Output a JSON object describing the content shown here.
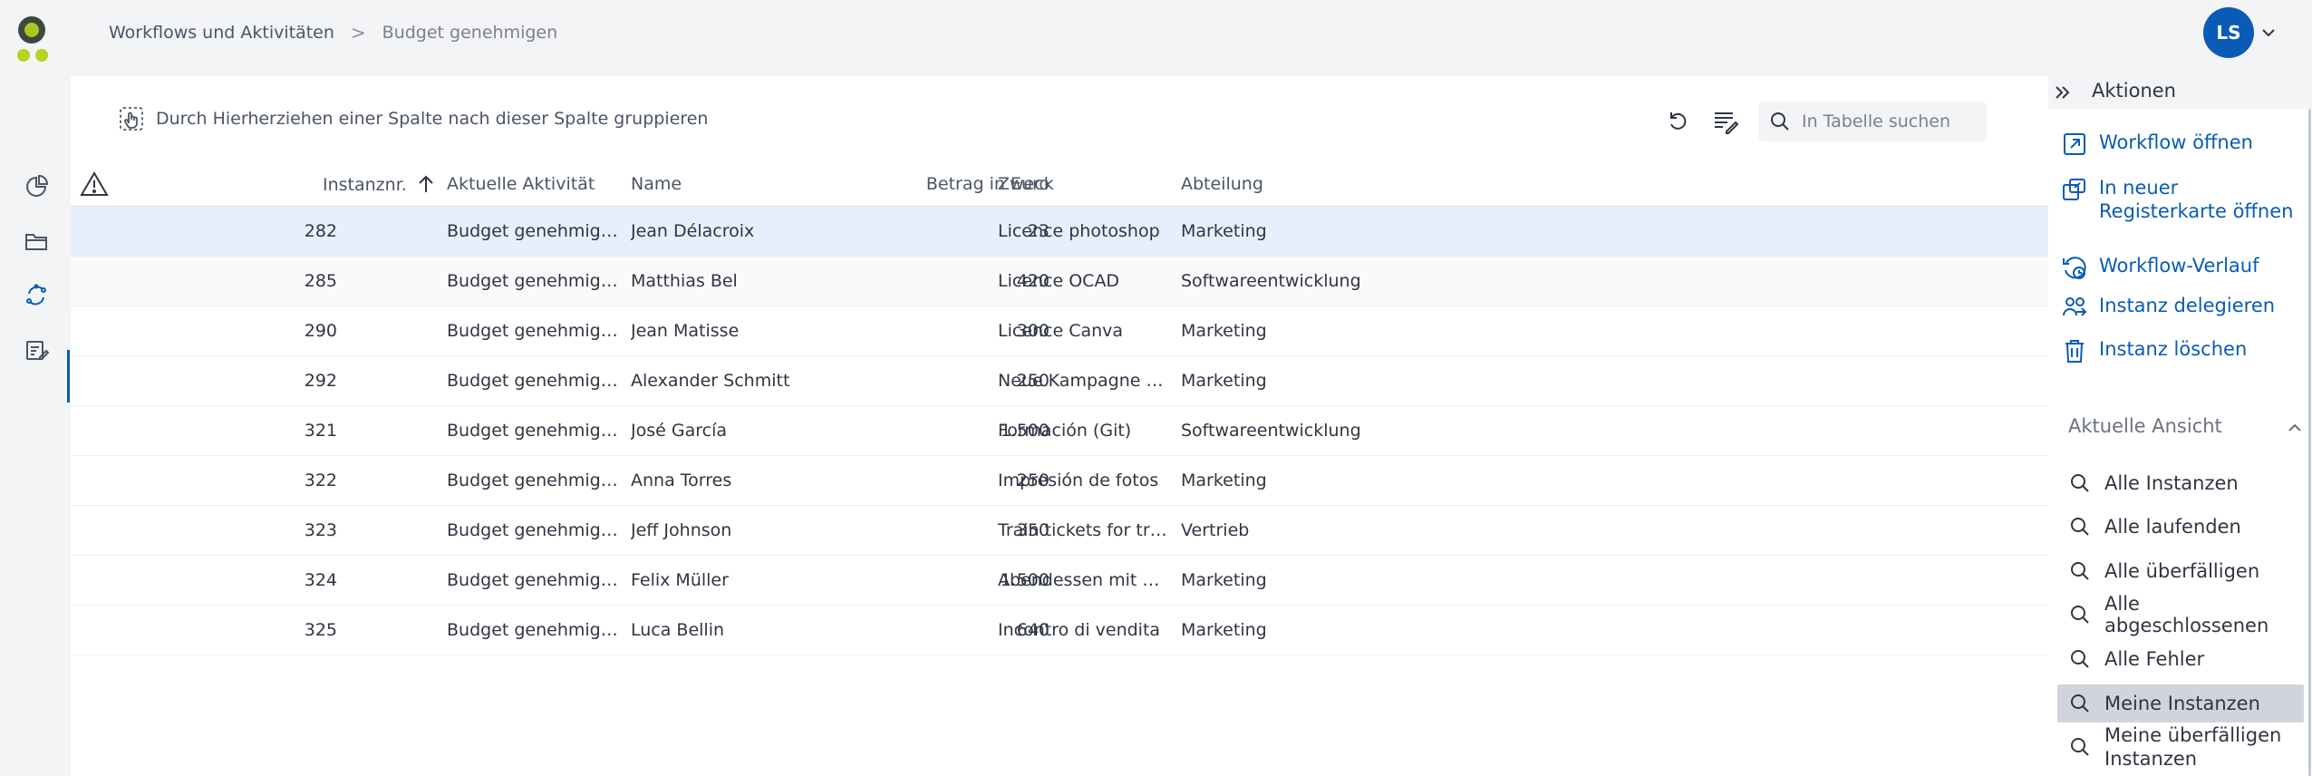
{
  "header": {
    "breadcrumb": [
      "Workflows und Aktivitäten",
      "Budget genehmigen"
    ],
    "breadcrumb_separator": ">",
    "user_initials": "LS"
  },
  "nav": {
    "icons": [
      "pie-chart-icon",
      "folder-icon",
      "refresh-cycle-icon",
      "task-edit-icon"
    ],
    "active_index": 2
  },
  "toolbar": {
    "group_hint": "Durch Hierherziehen einer Spalte nach dieser Spalte gruppieren",
    "search_placeholder": "In Tabelle suchen"
  },
  "table": {
    "columns": {
      "number": "Instanznr.",
      "activity": "Aktuelle Aktivität",
      "name": "Name",
      "amount": "Betrag in Euro",
      "purpose": "Zweck",
      "department": "Abteilung"
    },
    "sort_column": "number",
    "sort_direction": "ascending",
    "selected_row": 0,
    "rows": [
      {
        "number": "282",
        "activity": "Budget genehmigen",
        "name": "Jean Délacroix",
        "amount": "23",
        "purpose": "Licence photoshop",
        "department": "Marketing"
      },
      {
        "number": "285",
        "activity": "Budget genehmigen",
        "name": "Matthias Bel",
        "amount": "420",
        "purpose": "Licence OCAD",
        "department": "Softwareentwicklung"
      },
      {
        "number": "290",
        "activity": "Budget genehmigen",
        "name": "Jean Matisse",
        "amount": "300",
        "purpose": "Licence Canva",
        "department": "Marketing"
      },
      {
        "number": "292",
        "activity": "Budget genehmigen",
        "name": "Alexander Schmitt",
        "amount": "250",
        "purpose": "Neue Kampagne fü...",
        "department": "Marketing"
      },
      {
        "number": "321",
        "activity": "Budget genehmigen",
        "name": "José García",
        "amount": "1.500",
        "purpose": "Formación (Git)",
        "department": "Softwareentwicklung"
      },
      {
        "number": "322",
        "activity": "Budget genehmigen",
        "name": "Anna Torres",
        "amount": "250",
        "purpose": "Impresión de fotos",
        "department": "Marketing"
      },
      {
        "number": "323",
        "activity": "Budget genehmigen",
        "name": "Jeff Johnson",
        "amount": "350",
        "purpose": "Train tickets for tri...",
        "department": "Vertrieb"
      },
      {
        "number": "324",
        "activity": "Budget genehmigen",
        "name": "Felix Müller",
        "amount": "1.500",
        "purpose": "Abendessen mit de...",
        "department": "Marketing"
      },
      {
        "number": "325",
        "activity": "Budget genehmigen",
        "name": "Luca Bellin",
        "amount": "640",
        "purpose": "Incontro di vendita",
        "department": "Marketing"
      }
    ]
  },
  "actions_panel": {
    "title": "Aktionen",
    "actions": [
      {
        "label": "Workflow öffnen",
        "icon": "open-external-icon"
      },
      {
        "label": "In neuer Registerkarte öffnen",
        "icon": "new-tab-icon"
      },
      {
        "label": "Workflow-Verlauf",
        "icon": "history-icon"
      },
      {
        "label": "Instanz delegieren",
        "icon": "delegate-users-icon"
      },
      {
        "label": "Instanz löschen",
        "icon": "trash-icon"
      }
    ],
    "view_section_title": "Aktuelle Ansicht",
    "views": [
      {
        "label": "Alle Instanzen"
      },
      {
        "label": "Alle laufenden"
      },
      {
        "label": "Alle überfälligen"
      },
      {
        "label": "Alle abgeschlossenen"
      },
      {
        "label": "Alle Fehler"
      },
      {
        "label": "Meine Instanzen"
      },
      {
        "label": "Meine überfälligen Instanzen"
      }
    ],
    "active_view": 5
  },
  "colors": {
    "accent": "#0a5bb5",
    "selected_row": "#e6f0fb",
    "logo_green": "#b5d320"
  }
}
